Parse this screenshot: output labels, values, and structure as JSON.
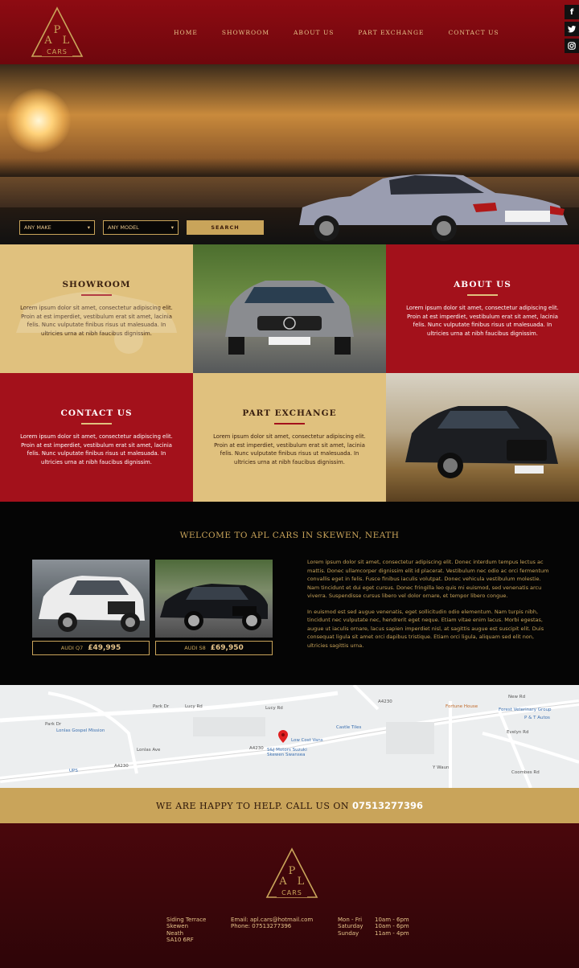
{
  "brand": {
    "logo_letters": "APL",
    "logo_word": "CARS"
  },
  "nav": [
    "HOME",
    "SHOWROOM",
    "ABOUT US",
    "PART EXCHANGE",
    "CONTACT US"
  ],
  "social": [
    {
      "icon": "facebook-icon",
      "glyph": "f"
    },
    {
      "icon": "twitter-icon",
      "glyph": "t"
    },
    {
      "icon": "instagram-icon",
      "glyph": "◎"
    }
  ],
  "search": {
    "make": "ANY MAKE",
    "model": "ANY MODEL",
    "button": "SEARCH"
  },
  "tiles": {
    "showroom": {
      "title": "SHOWROOM",
      "text": "Lorem ipsum dolor sit amet, consectetur adipiscing elit. Proin at est imperdiet, vestibulum erat sit amet, lacinia felis. Nunc vulputate finibus risus ut malesuada. In ultricies urna at nibh faucibus dignissim."
    },
    "about": {
      "title": "ABOUT US",
      "text": "Lorem ipsum dolor sit amet, consectetur adipiscing elit. Proin at est imperdiet, vestibulum erat sit amet, lacinia felis. Nunc vulputate finibus risus ut malesuada. In ultricies urna at nibh faucibus dignissim."
    },
    "contact": {
      "title": "CONTACT US",
      "text": "Lorem ipsum dolor sit amet, consectetur adipiscing elit. Proin at est imperdiet, vestibulum erat sit amet, lacinia felis. Nunc vulputate finibus risus ut malesuada. In ultricies urna at nibh faucibus dignissim."
    },
    "part_exchange": {
      "title": "PART EXCHANGE",
      "text": "Lorem ipsum dolor sit amet, consectetur adipiscing elit. Proin at est imperdiet, vestibulum erat sit amet, lacinia felis. Nunc vulputate finibus risus ut malesuada. In ultricies urna at nibh faucibus dignissim."
    }
  },
  "welcome": {
    "heading": "WELCOME TO APL CARS IN SKEWEN, NEATH",
    "cars": [
      {
        "model": "AUDI Q7",
        "price": "£49,995"
      },
      {
        "model": "AUDI S8",
        "price": "£69,950"
      }
    ],
    "para1": "Lorem ipsum dolor sit amet, consectetur adipiscing elit. Donec interdum tempus lectus ac mattis. Donec ullamcorper dignissim elit id placerat. Vestibulum nec odio ac orci fermentum convallis eget in felis. Fusce finibus iaculis volutpat. Donec vehicula vestibulum molestie. Nam tincidunt et dui eget cursus. Donec fringilla leo quis mi euismod, sed venenatis arcu viverra. Suspendisse cursus libero vel dolor ornare, et tempor libero congue.",
    "para2": "In euismod est sed augue venenatis, eget sollicitudin odio elementum. Nam turpis nibh, tincidunt nec vulputate nec, hendrerit eget neque. Etiam vitae enim lacus. Morbi egestas, augue ut iaculis ornare, lacus sapien imperdiet nisl, at sagittis augue est suscipit elit. Duis consequat ligula sit amet orci dapibus tristique. Etiam orci ligula, aliquam sed elit non, ultricies sagittis urna."
  },
  "map": {
    "labels": [
      "Park Dr",
      "Lucy Rd",
      "Lucy Rd",
      "Park Dr",
      "Lonlas Gospel Mission",
      "Castle Tiles",
      "Low Cost Vans",
      "S&J Motors Suzuki Skewen Swansea",
      "A4230",
      "A4230",
      "A4230",
      "New Rd",
      "Fortune House",
      "Forest Veterinary Group",
      "P & T Autos",
      "Evelyn Rd",
      "Coombes Rd",
      "Y Waun",
      "UPS",
      "Lonlas Ave"
    ]
  },
  "cta": {
    "text": "WE ARE HAPPY TO HELP. CALL US ON",
    "phone": "07513277396"
  },
  "footer": {
    "address": [
      "Siding Terrace",
      "Skewen",
      "Neath",
      "SA10 6RF"
    ],
    "email": "Email: apl.cars@hotmail.com",
    "phone": "Phone: 07513277396",
    "hours": [
      {
        "day": "Mon - Fri",
        "time": "10am - 6pm"
      },
      {
        "day": "Saturday",
        "time": "10am - 6pm"
      },
      {
        "day": "Sunday",
        "time": "11am - 4pm"
      }
    ]
  }
}
